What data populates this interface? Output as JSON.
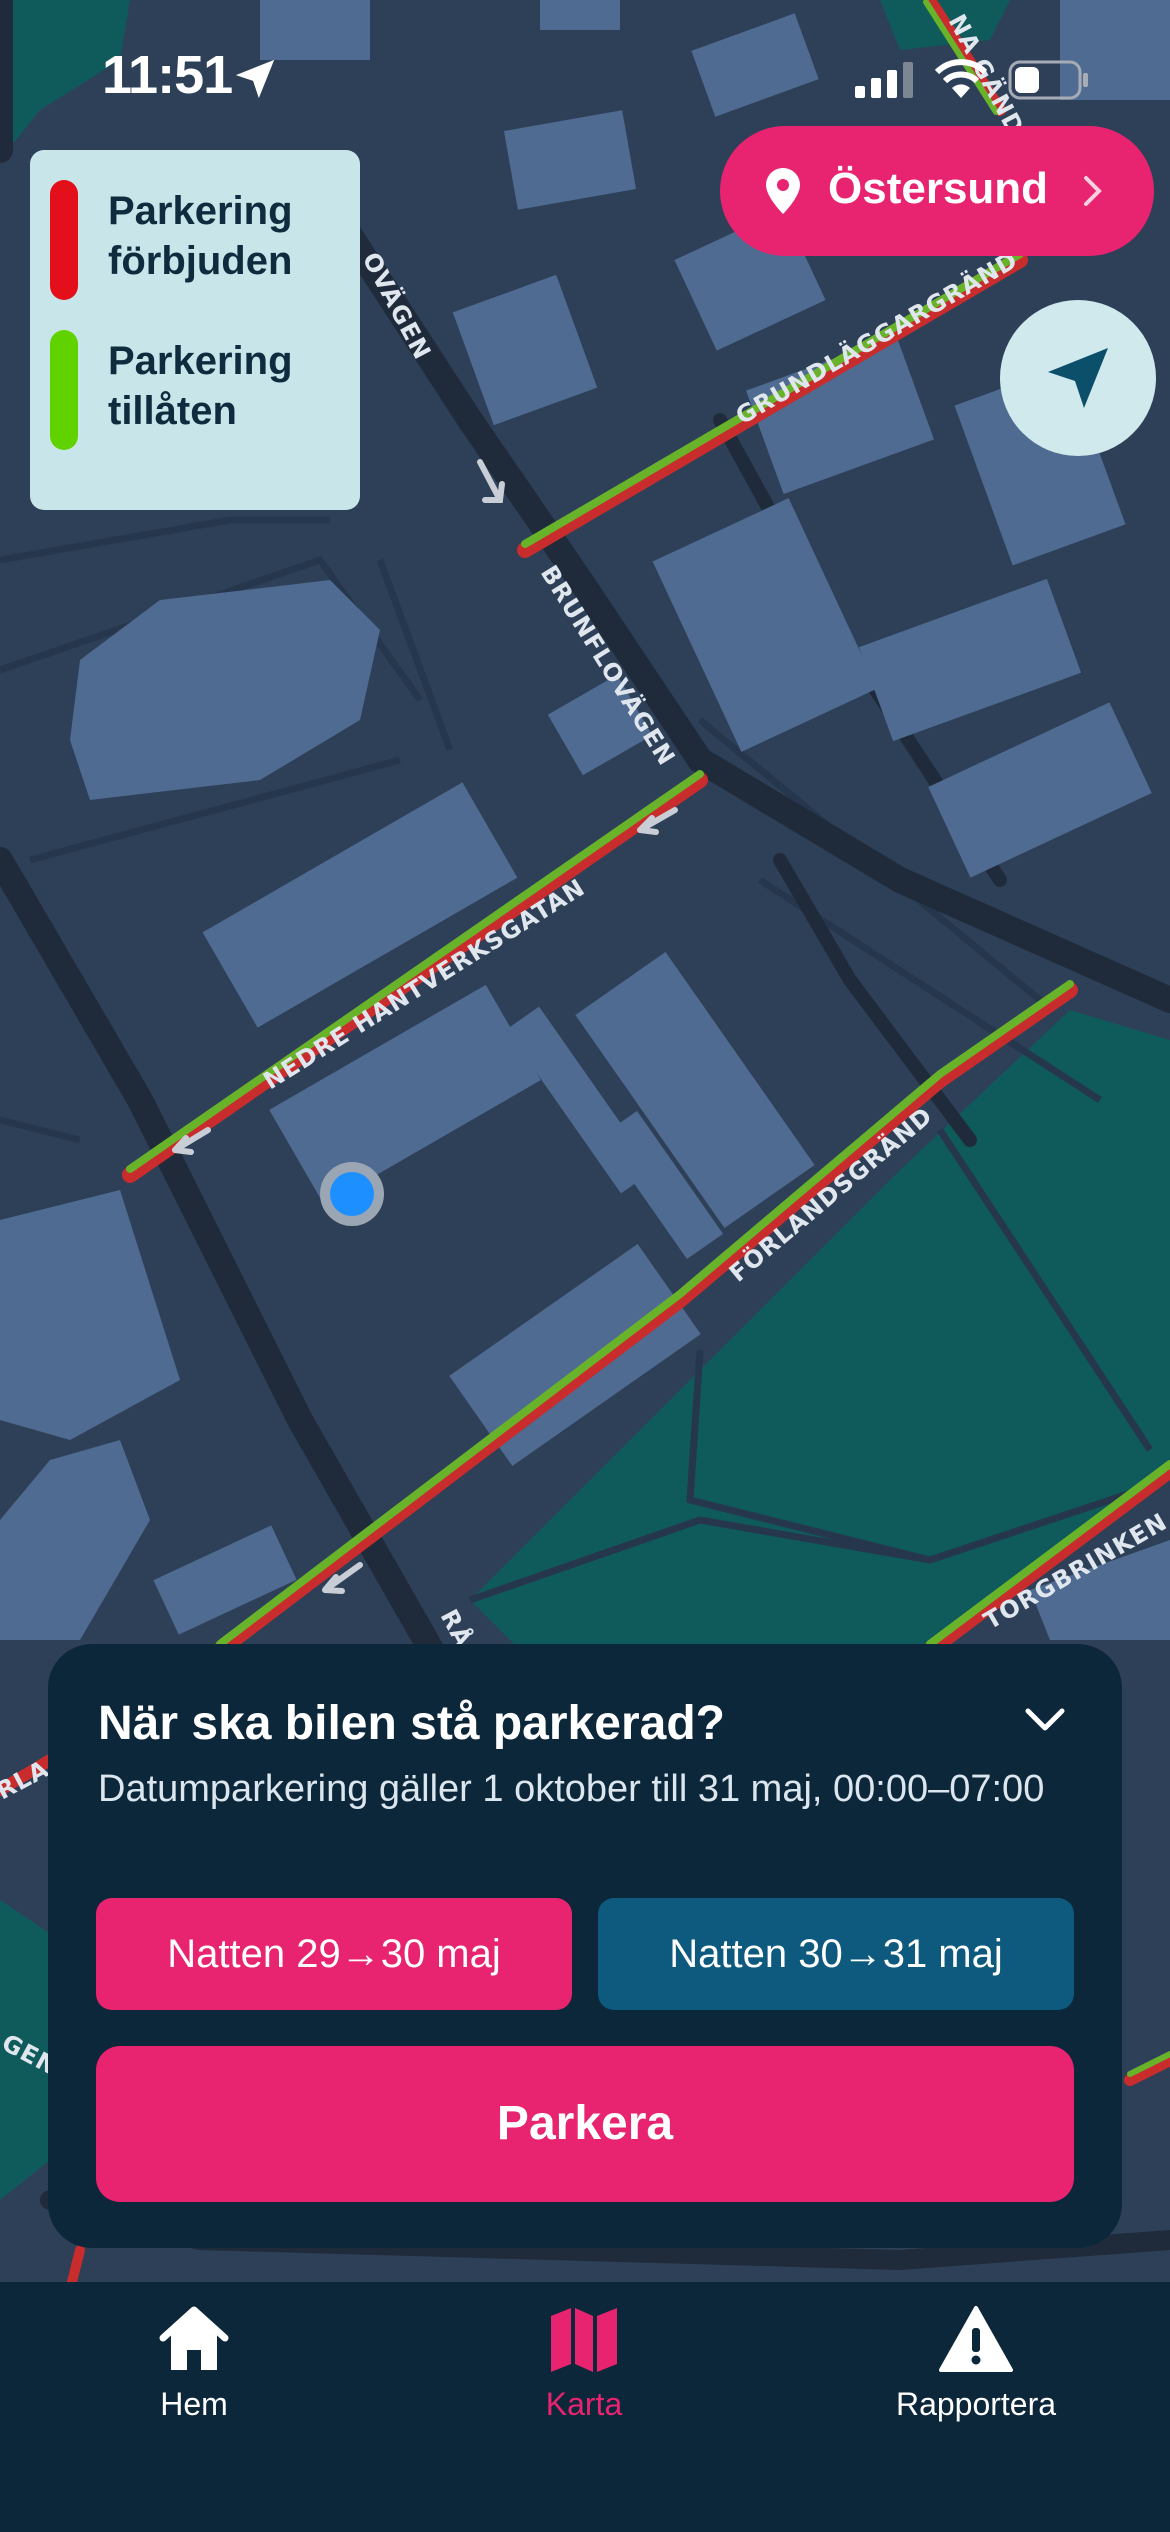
{
  "status_bar": {
    "time": "11:51"
  },
  "legend": {
    "items": [
      {
        "label": "Parkering förbjuden",
        "color": "#e3101b"
      },
      {
        "label": "Parkering tillåten",
        "color": "#5fd200"
      }
    ]
  },
  "city_selector": {
    "label": "Östersund",
    "icon": "location-pin-icon"
  },
  "locate_button": {
    "icon": "navigation-arrow-icon"
  },
  "map": {
    "street_labels": {
      "brunflovagen_top": "OVÄGEN",
      "grundlaggargrand": "GRUNDLÄGGARGRÄND",
      "top_right": "NA GÄND",
      "brunflovagen": "BRUNFLOVÄGEN",
      "nedre_hantverksgatan": "NEDRE HANTVERKSGATAN",
      "forlandsgrand": "FÖRLANDSGRÄND",
      "torgbrinken": "TORGBRINKEN",
      "ra": "RÅ",
      "left_1": "RLA",
      "left_2": "GEN"
    },
    "user_location_color": "#1e8fff"
  },
  "parking_sheet": {
    "title": "När ska bilen stå parkerad?",
    "subtitle": "Datumparkering gäller 1 oktober till 31 maj, 00:00–07:00",
    "options": [
      {
        "label": "Natten 29→30 maj",
        "selected": true
      },
      {
        "label": "Natten 30→31 maj",
        "selected": false
      }
    ],
    "primary_action": "Parkera"
  },
  "tabbar": {
    "items": [
      {
        "label": "Hem",
        "icon": "home-icon",
        "active": false
      },
      {
        "label": "Karta",
        "icon": "map-icon",
        "active": true
      },
      {
        "label": "Rapportera",
        "icon": "warning-icon",
        "active": false
      }
    ]
  },
  "colors": {
    "accent": "#e8236f",
    "sheet_bg": "#0c263a",
    "secondary_button": "#0d5a7e",
    "map_bg": "#2e4058",
    "building": "#4f6b91",
    "park": "#0f5a5a"
  }
}
